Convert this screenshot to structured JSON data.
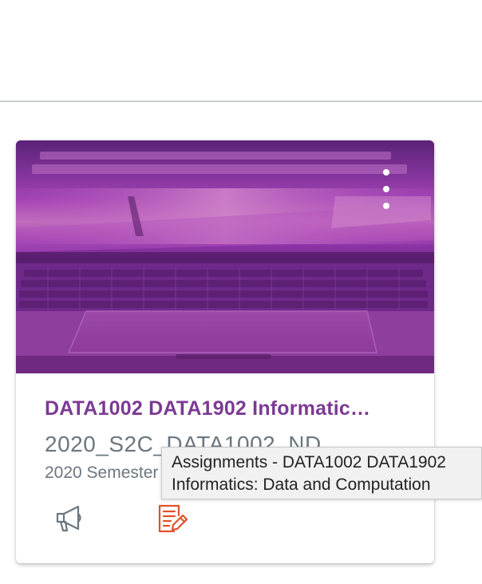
{
  "course_card": {
    "title": "DATA1002 DATA1902 Informatic…",
    "code": "2020_S2C_DATA1002_ND",
    "term": "2020 Semester 2",
    "hero_color": "#7b3a93",
    "hero_image": "laptop-keyboard-photo",
    "menu_icon": "kebab-menu-icon",
    "actions": [
      {
        "name": "announcements",
        "icon": "megaphone-icon",
        "color": "#6b7780"
      },
      {
        "name": "assignments",
        "icon": "assignment-edit-icon",
        "color": "#e0522a"
      }
    ]
  },
  "tooltip": {
    "line1": "Assignments - DATA1002 DATA1902",
    "line2": "Informatics: Data and Computation"
  },
  "colors": {
    "title": "#7b3a93",
    "secondary_text": "#6b7780",
    "divider": "#c7cdd1",
    "tooltip_bg": "#f1f1f1"
  }
}
